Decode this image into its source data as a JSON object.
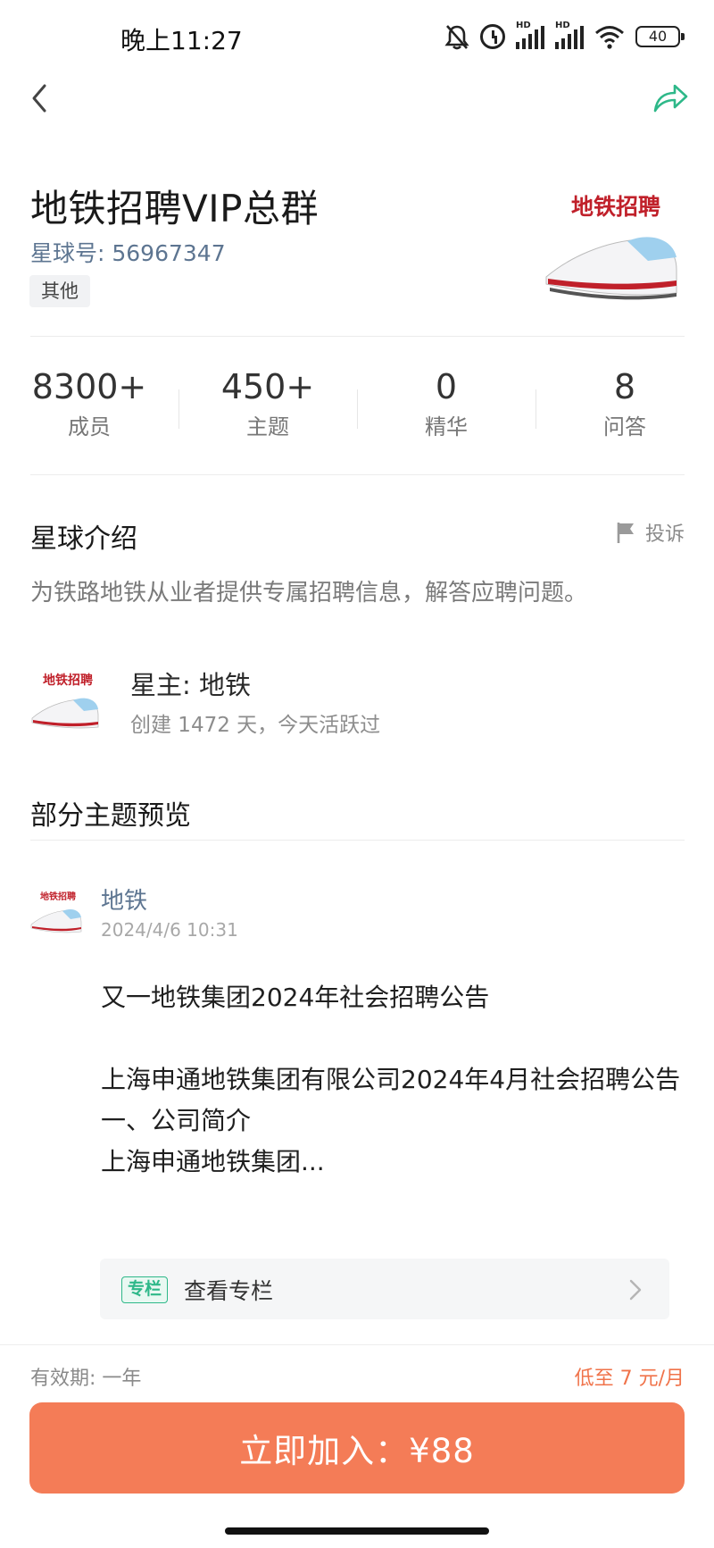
{
  "status_bar": {
    "time": "晚上11:27",
    "signal_hd_1": "HD",
    "signal_hd_2": "HD",
    "battery": "40"
  },
  "header": {
    "title": "地铁招聘VIP总群",
    "planet_id": "星球号: 56967347",
    "category": "其他",
    "logo_text": "地铁招聘"
  },
  "stats": [
    {
      "value": "8300+",
      "label": "成员"
    },
    {
      "value": "450+",
      "label": "主题"
    },
    {
      "value": "0",
      "label": "精华"
    },
    {
      "value": "8",
      "label": "问答"
    }
  ],
  "intro": {
    "title": "星球介绍",
    "report_label": "投诉",
    "text": "为铁路地铁从业者提供专属招聘信息，解答应聘问题。"
  },
  "owner": {
    "avatar_text": "地铁招聘",
    "name": "星主: 地铁",
    "meta": "创建 1472 天，今天活跃过"
  },
  "preview": {
    "title": "部分主题预览",
    "post": {
      "avatar_text": "地铁招聘",
      "author": "地铁",
      "time": "2024/4/6 10:31",
      "lines": [
        "又一地铁集团2024年社会招聘公告",
        "上海申通地铁集团有限公司2024年4月社会招聘公告",
        "一、公司简介",
        "上海申通地铁集团..."
      ]
    },
    "column": {
      "badge": "专栏",
      "label": "查看专栏"
    }
  },
  "footer": {
    "validity": "有效期: 一年",
    "price_note": "低至 7 元/月",
    "join_button": "立即加入：¥88"
  },
  "colors": {
    "accent_orange": "#f47c57",
    "link_blue": "#5d7591",
    "column_green": "#2eb889",
    "logo_red": "#c0202a"
  },
  "icons": [
    "bell-off-icon",
    "alarm-icon",
    "signal-icon",
    "wifi-icon",
    "battery-icon",
    "back-arrow-icon",
    "share-icon",
    "flag-icon",
    "chevron-right-icon"
  ]
}
